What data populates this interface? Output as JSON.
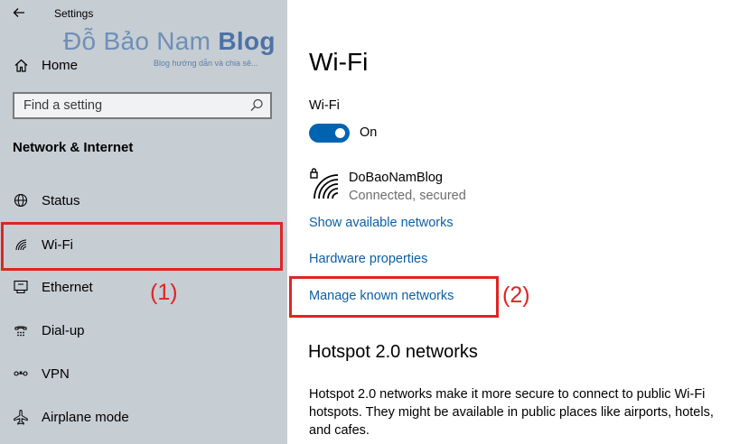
{
  "window": {
    "title": "Settings"
  },
  "watermark": {
    "text_regular": "Đỗ Bảo Nam",
    "text_bold": "Blog",
    "subtitle": "Blog hướng dẫn và chia sẻ..."
  },
  "sidebar": {
    "home_label": "Home",
    "search": {
      "placeholder": "Find a setting"
    },
    "section_title": "Network & Internet",
    "items": [
      {
        "label": "Status",
        "icon": "status-globe-icon"
      },
      {
        "label": "Wi-Fi",
        "icon": "wifi-icon"
      },
      {
        "label": "Ethernet",
        "icon": "ethernet-icon"
      },
      {
        "label": "Dial-up",
        "icon": "dial-up-icon"
      },
      {
        "label": "VPN",
        "icon": "vpn-icon"
      },
      {
        "label": "Airplane mode",
        "icon": "airplane-icon"
      }
    ]
  },
  "annotations": {
    "step1": "(1)",
    "step2": "(2)"
  },
  "main": {
    "page_title": "Wi-Fi",
    "wifi_toggle_label": "Wi-Fi",
    "wifi_toggle_state": "On",
    "network": {
      "name": "DoBaoNamBlog",
      "status": "Connected, secured"
    },
    "links": {
      "show_available": "Show available networks",
      "hardware_properties": "Hardware properties",
      "manage_known": "Manage known networks"
    },
    "hotspot": {
      "heading": "Hotspot 2.0 networks",
      "description": "Hotspot 2.0 networks make it more secure to connect to public Wi-Fi hotspots. They might be available in public places like airports, hotels, and cafes."
    }
  },
  "colors": {
    "accent": "#0063b1",
    "link": "#0c5fa6",
    "annotation": "#e02424",
    "sidebar_bg": "#c6cdd3"
  }
}
